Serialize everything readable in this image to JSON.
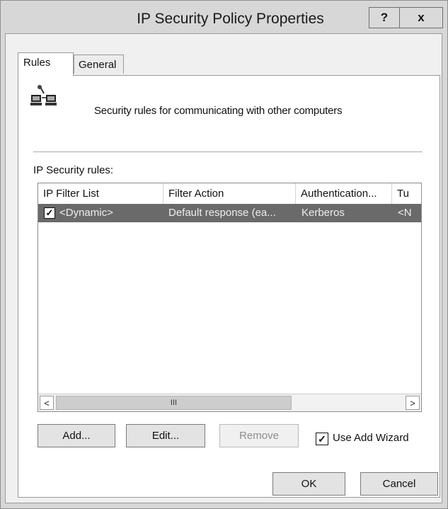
{
  "window": {
    "title": "IP Security Policy Properties",
    "help_label": "?",
    "close_label": "x"
  },
  "tabs": [
    {
      "label": "Rules"
    },
    {
      "label": "General"
    }
  ],
  "intro": {
    "text": "Security rules for communicating with other computers",
    "icon": "network-computers-icon"
  },
  "rules_section": {
    "label": "IP Security rules:"
  },
  "table": {
    "columns": [
      "IP Filter List",
      "Filter Action",
      "Authentication...",
      "Tu"
    ],
    "rows": [
      {
        "checked": true,
        "cells": [
          "<Dynamic>",
          "Default response (ea...",
          "Kerberos",
          "<N"
        ]
      }
    ]
  },
  "scrollbar": {
    "left_arrow": "<",
    "right_arrow": ">",
    "grip": "III"
  },
  "buttons": {
    "add": "Add...",
    "edit": "Edit...",
    "remove": "Remove",
    "ok": "OK",
    "cancel": "Cancel"
  },
  "use_add_wizard": {
    "label": "Use Add Wizard",
    "checked": true
  },
  "colors": {
    "selected_row": "#6a6a6a",
    "panel": "#ffffff",
    "chrome": "#d7d7d7"
  }
}
